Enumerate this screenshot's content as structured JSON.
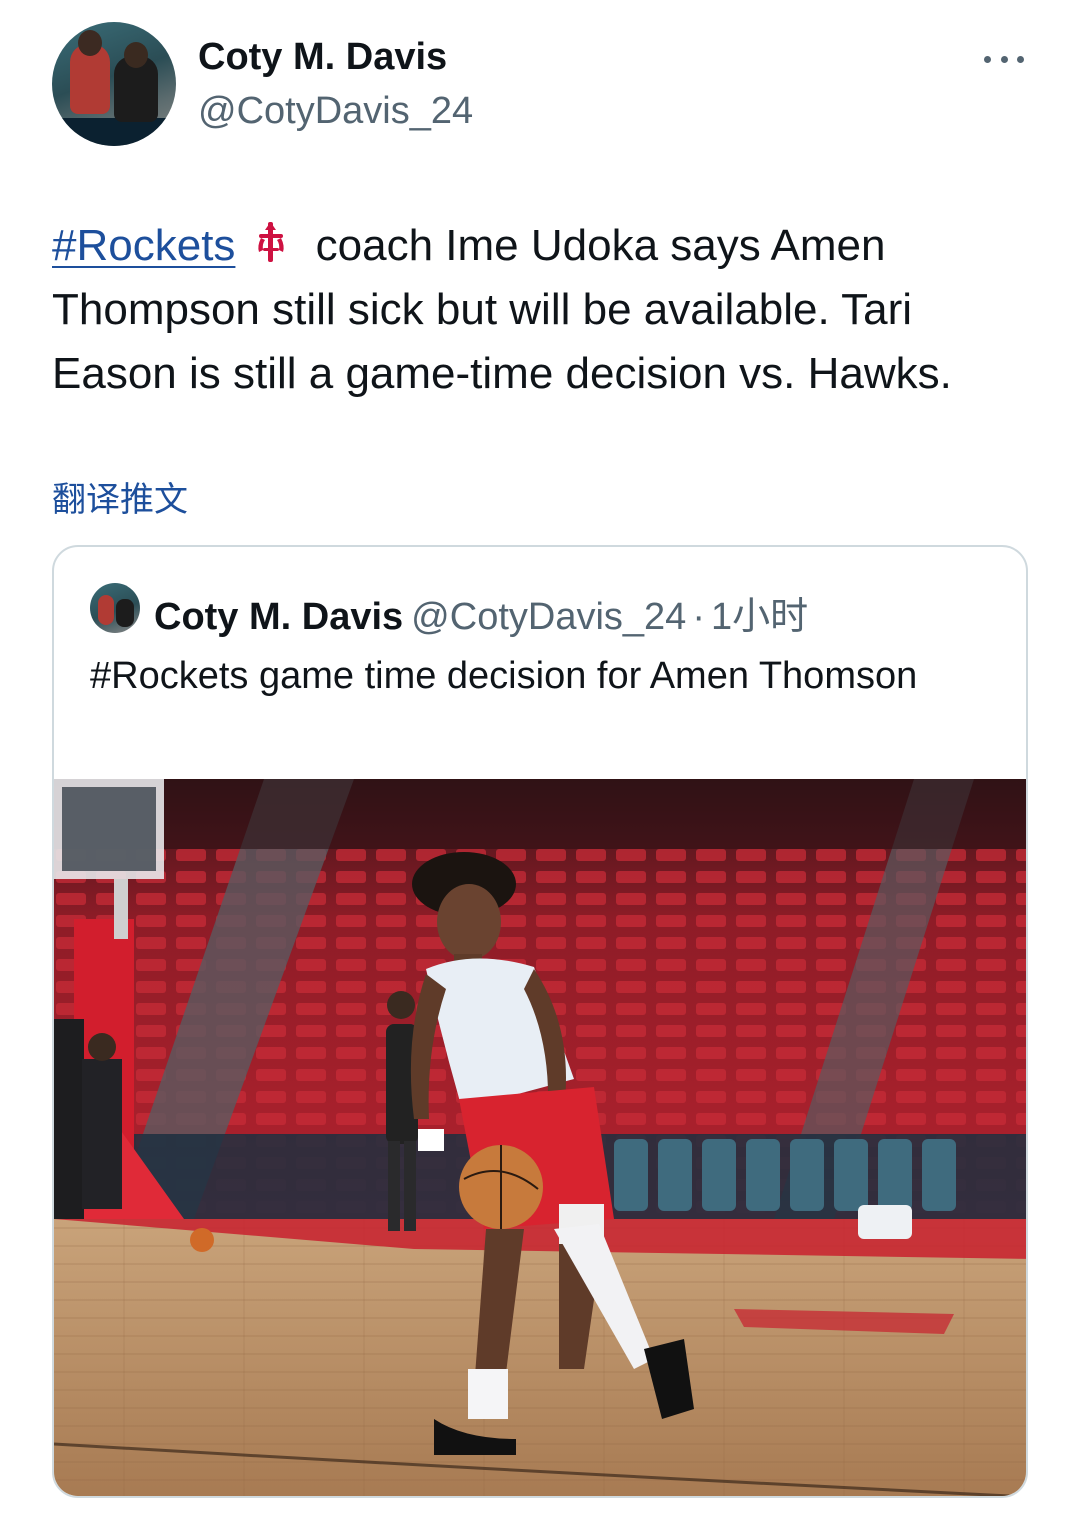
{
  "author": {
    "name": "Coty M. Davis",
    "handle": "@CotyDavis_24"
  },
  "more_icon": "more-horizontal-icon",
  "tweet": {
    "hashtag": "#Rockets",
    "emoji_icon": "houston-rockets-logo-icon",
    "text": " coach Ime Udoka says Amen Thompson still sick but will be available. Tari Eason is still a game-time decision vs. Hawks."
  },
  "translate_label": "翻译推文",
  "quoted": {
    "name": "Coty M. Davis",
    "handle": "@CotyDavis_24",
    "separator": "·",
    "time": "1小时",
    "text": "#Rockets game time decision for Amen Thomson",
    "image_alt": "Player dribbling a basketball on the Rockets home court"
  },
  "colors": {
    "link": "#1d4f9c",
    "secondary_text": "#536471",
    "border": "#cfd9de",
    "rockets_red": "#ce1141"
  }
}
